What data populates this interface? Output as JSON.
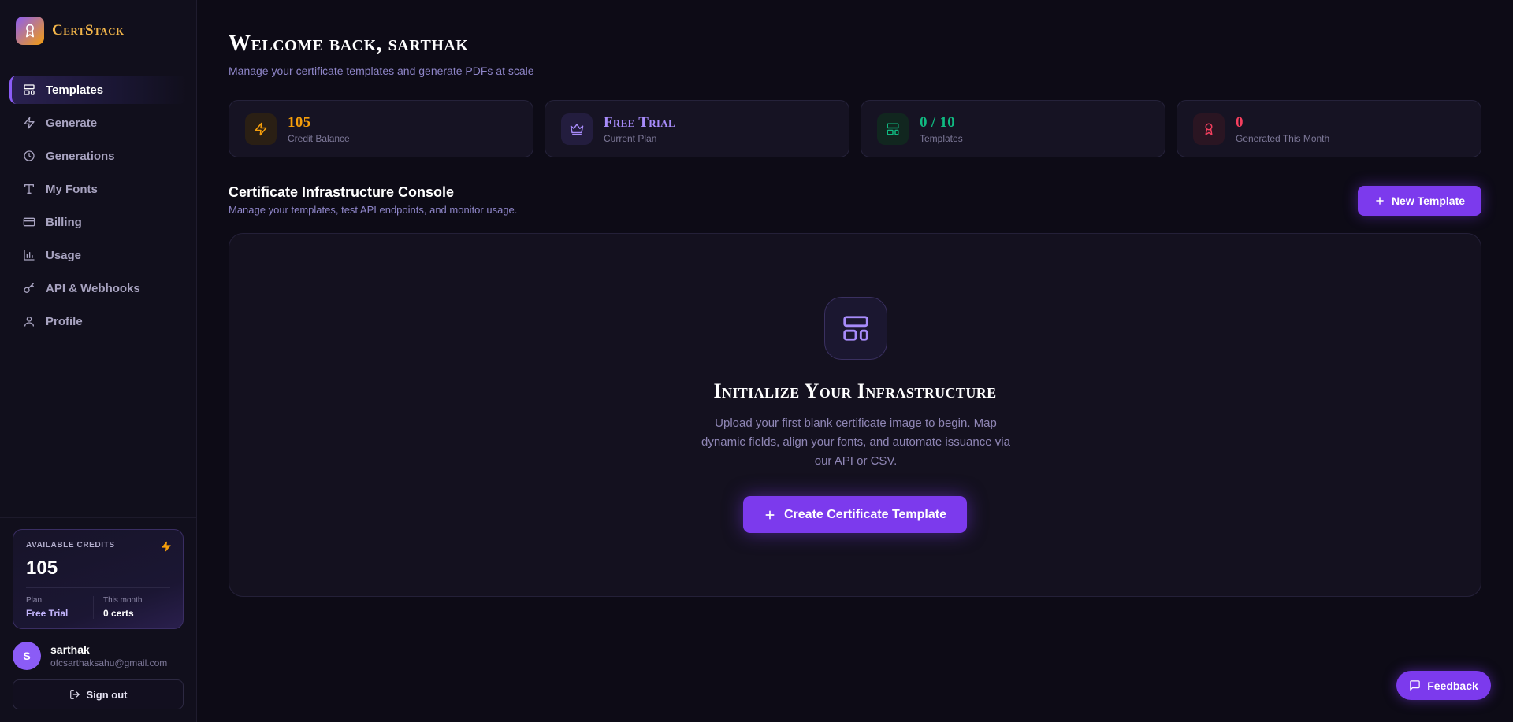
{
  "brand": {
    "name": "CertStack",
    "logo_icon": "award-icon"
  },
  "nav": [
    {
      "label": "Templates",
      "icon": "layout-template-icon",
      "active": true
    },
    {
      "label": "Generate",
      "icon": "zap-icon",
      "active": false
    },
    {
      "label": "Generations",
      "icon": "clock-icon",
      "active": false
    },
    {
      "label": "My Fonts",
      "icon": "type-icon",
      "active": false
    },
    {
      "label": "Billing",
      "icon": "credit-card-icon",
      "active": false
    },
    {
      "label": "Usage",
      "icon": "bar-chart-icon",
      "active": false
    },
    {
      "label": "API & Webhooks",
      "icon": "key-icon",
      "active": false
    },
    {
      "label": "Profile",
      "icon": "user-icon",
      "active": false
    }
  ],
  "credits_card": {
    "label": "AVAILABLE CREDITS",
    "value": "105",
    "plan_label": "Plan",
    "plan_value": "Free Trial",
    "month_label": "This month",
    "month_value": "0 certs"
  },
  "user": {
    "initial": "S",
    "name": "sarthak",
    "email": "ofcsarthaksahu@gmail.com",
    "signout_label": "Sign out"
  },
  "header": {
    "welcome": "Welcome back, sarthak",
    "subtitle": "Manage your certificate templates and generate PDFs at scale"
  },
  "stats": [
    {
      "value": "105",
      "label": "Credit Balance",
      "icon": "zap-icon",
      "color": "#f59e0b"
    },
    {
      "value": "Free Trial",
      "label": "Current Plan",
      "icon": "crown-icon",
      "color": "#a78bfa"
    },
    {
      "value": "0 / 10",
      "label": "Templates",
      "icon": "layout-template-icon",
      "color": "#10b981"
    },
    {
      "value": "0",
      "label": "Generated This Month",
      "icon": "award-icon",
      "color": "#f43f5e"
    }
  ],
  "console": {
    "title": "Certificate Infrastructure Console",
    "subtitle": "Manage your templates, test API endpoints, and monitor usage.",
    "new_template_label": "New Template"
  },
  "empty_state": {
    "title": "Initialize Your Infrastructure",
    "description": "Upload your first blank certificate image to begin. Map dynamic fields, align your fonts, and automate issuance via our API or CSV.",
    "button_label": "Create Certificate Template"
  },
  "feedback_label": "Feedback",
  "colors": {
    "accent": "#7c3aed",
    "background": "#0d0b16",
    "brand": "#f2b54a"
  }
}
